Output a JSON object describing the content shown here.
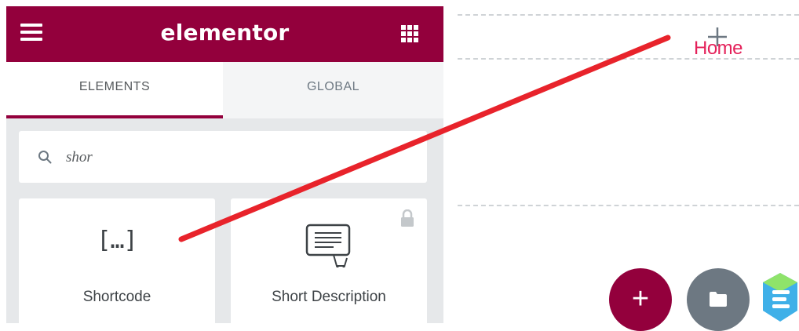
{
  "header": {
    "brand": "elementor",
    "menu_icon": "hamburger-icon",
    "apps_icon": "apps-grid-icon",
    "color": "#93003c"
  },
  "tabs": [
    {
      "label": "ELEMENTS",
      "active": true
    },
    {
      "label": "GLOBAL",
      "active": false
    }
  ],
  "search": {
    "value": "shor",
    "icon": "search-icon"
  },
  "widgets": [
    {
      "label": "Shortcode",
      "icon": "shortcode-icon",
      "locked": false
    },
    {
      "label": "Short Description",
      "icon": "short-description-icon",
      "locked": true
    }
  ],
  "canvas": {
    "link_text": "Home",
    "link_color": "#e4215a",
    "add_button": "+",
    "folder_icon": "folder-icon",
    "logo_icon": "elementskit-logo-icon"
  },
  "annotation": {
    "color": "#e8232b"
  }
}
